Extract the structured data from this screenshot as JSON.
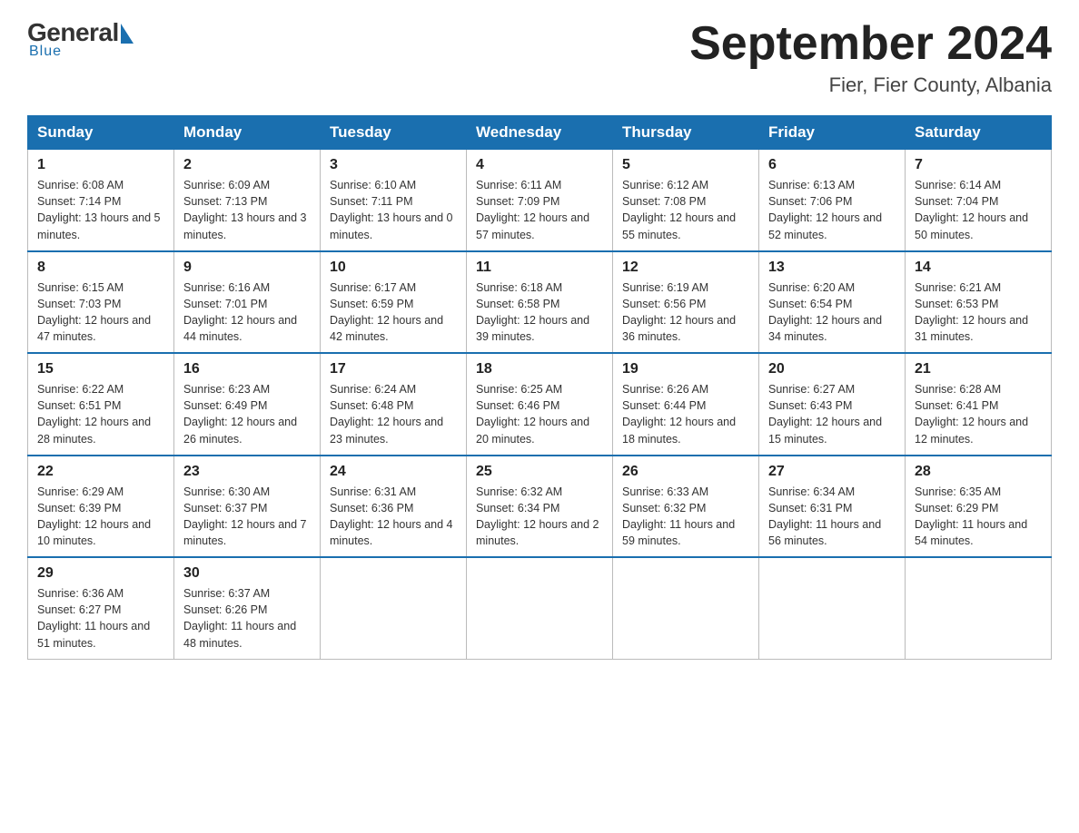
{
  "header": {
    "logo_general": "General",
    "logo_blue": "Blue",
    "month_title": "September 2024",
    "location": "Fier, Fier County, Albania"
  },
  "weekdays": [
    "Sunday",
    "Monday",
    "Tuesday",
    "Wednesday",
    "Thursday",
    "Friday",
    "Saturday"
  ],
  "weeks": [
    [
      {
        "day": "1",
        "sunrise": "6:08 AM",
        "sunset": "7:14 PM",
        "daylight": "13 hours and 5 minutes."
      },
      {
        "day": "2",
        "sunrise": "6:09 AM",
        "sunset": "7:13 PM",
        "daylight": "13 hours and 3 minutes."
      },
      {
        "day": "3",
        "sunrise": "6:10 AM",
        "sunset": "7:11 PM",
        "daylight": "13 hours and 0 minutes."
      },
      {
        "day": "4",
        "sunrise": "6:11 AM",
        "sunset": "7:09 PM",
        "daylight": "12 hours and 57 minutes."
      },
      {
        "day": "5",
        "sunrise": "6:12 AM",
        "sunset": "7:08 PM",
        "daylight": "12 hours and 55 minutes."
      },
      {
        "day": "6",
        "sunrise": "6:13 AM",
        "sunset": "7:06 PM",
        "daylight": "12 hours and 52 minutes."
      },
      {
        "day": "7",
        "sunrise": "6:14 AM",
        "sunset": "7:04 PM",
        "daylight": "12 hours and 50 minutes."
      }
    ],
    [
      {
        "day": "8",
        "sunrise": "6:15 AM",
        "sunset": "7:03 PM",
        "daylight": "12 hours and 47 minutes."
      },
      {
        "day": "9",
        "sunrise": "6:16 AM",
        "sunset": "7:01 PM",
        "daylight": "12 hours and 44 minutes."
      },
      {
        "day": "10",
        "sunrise": "6:17 AM",
        "sunset": "6:59 PM",
        "daylight": "12 hours and 42 minutes."
      },
      {
        "day": "11",
        "sunrise": "6:18 AM",
        "sunset": "6:58 PM",
        "daylight": "12 hours and 39 minutes."
      },
      {
        "day": "12",
        "sunrise": "6:19 AM",
        "sunset": "6:56 PM",
        "daylight": "12 hours and 36 minutes."
      },
      {
        "day": "13",
        "sunrise": "6:20 AM",
        "sunset": "6:54 PM",
        "daylight": "12 hours and 34 minutes."
      },
      {
        "day": "14",
        "sunrise": "6:21 AM",
        "sunset": "6:53 PM",
        "daylight": "12 hours and 31 minutes."
      }
    ],
    [
      {
        "day": "15",
        "sunrise": "6:22 AM",
        "sunset": "6:51 PM",
        "daylight": "12 hours and 28 minutes."
      },
      {
        "day": "16",
        "sunrise": "6:23 AM",
        "sunset": "6:49 PM",
        "daylight": "12 hours and 26 minutes."
      },
      {
        "day": "17",
        "sunrise": "6:24 AM",
        "sunset": "6:48 PM",
        "daylight": "12 hours and 23 minutes."
      },
      {
        "day": "18",
        "sunrise": "6:25 AM",
        "sunset": "6:46 PM",
        "daylight": "12 hours and 20 minutes."
      },
      {
        "day": "19",
        "sunrise": "6:26 AM",
        "sunset": "6:44 PM",
        "daylight": "12 hours and 18 minutes."
      },
      {
        "day": "20",
        "sunrise": "6:27 AM",
        "sunset": "6:43 PM",
        "daylight": "12 hours and 15 minutes."
      },
      {
        "day": "21",
        "sunrise": "6:28 AM",
        "sunset": "6:41 PM",
        "daylight": "12 hours and 12 minutes."
      }
    ],
    [
      {
        "day": "22",
        "sunrise": "6:29 AM",
        "sunset": "6:39 PM",
        "daylight": "12 hours and 10 minutes."
      },
      {
        "day": "23",
        "sunrise": "6:30 AM",
        "sunset": "6:37 PM",
        "daylight": "12 hours and 7 minutes."
      },
      {
        "day": "24",
        "sunrise": "6:31 AM",
        "sunset": "6:36 PM",
        "daylight": "12 hours and 4 minutes."
      },
      {
        "day": "25",
        "sunrise": "6:32 AM",
        "sunset": "6:34 PM",
        "daylight": "12 hours and 2 minutes."
      },
      {
        "day": "26",
        "sunrise": "6:33 AM",
        "sunset": "6:32 PM",
        "daylight": "11 hours and 59 minutes."
      },
      {
        "day": "27",
        "sunrise": "6:34 AM",
        "sunset": "6:31 PM",
        "daylight": "11 hours and 56 minutes."
      },
      {
        "day": "28",
        "sunrise": "6:35 AM",
        "sunset": "6:29 PM",
        "daylight": "11 hours and 54 minutes."
      }
    ],
    [
      {
        "day": "29",
        "sunrise": "6:36 AM",
        "sunset": "6:27 PM",
        "daylight": "11 hours and 51 minutes."
      },
      {
        "day": "30",
        "sunrise": "6:37 AM",
        "sunset": "6:26 PM",
        "daylight": "11 hours and 48 minutes."
      },
      null,
      null,
      null,
      null,
      null
    ]
  ]
}
